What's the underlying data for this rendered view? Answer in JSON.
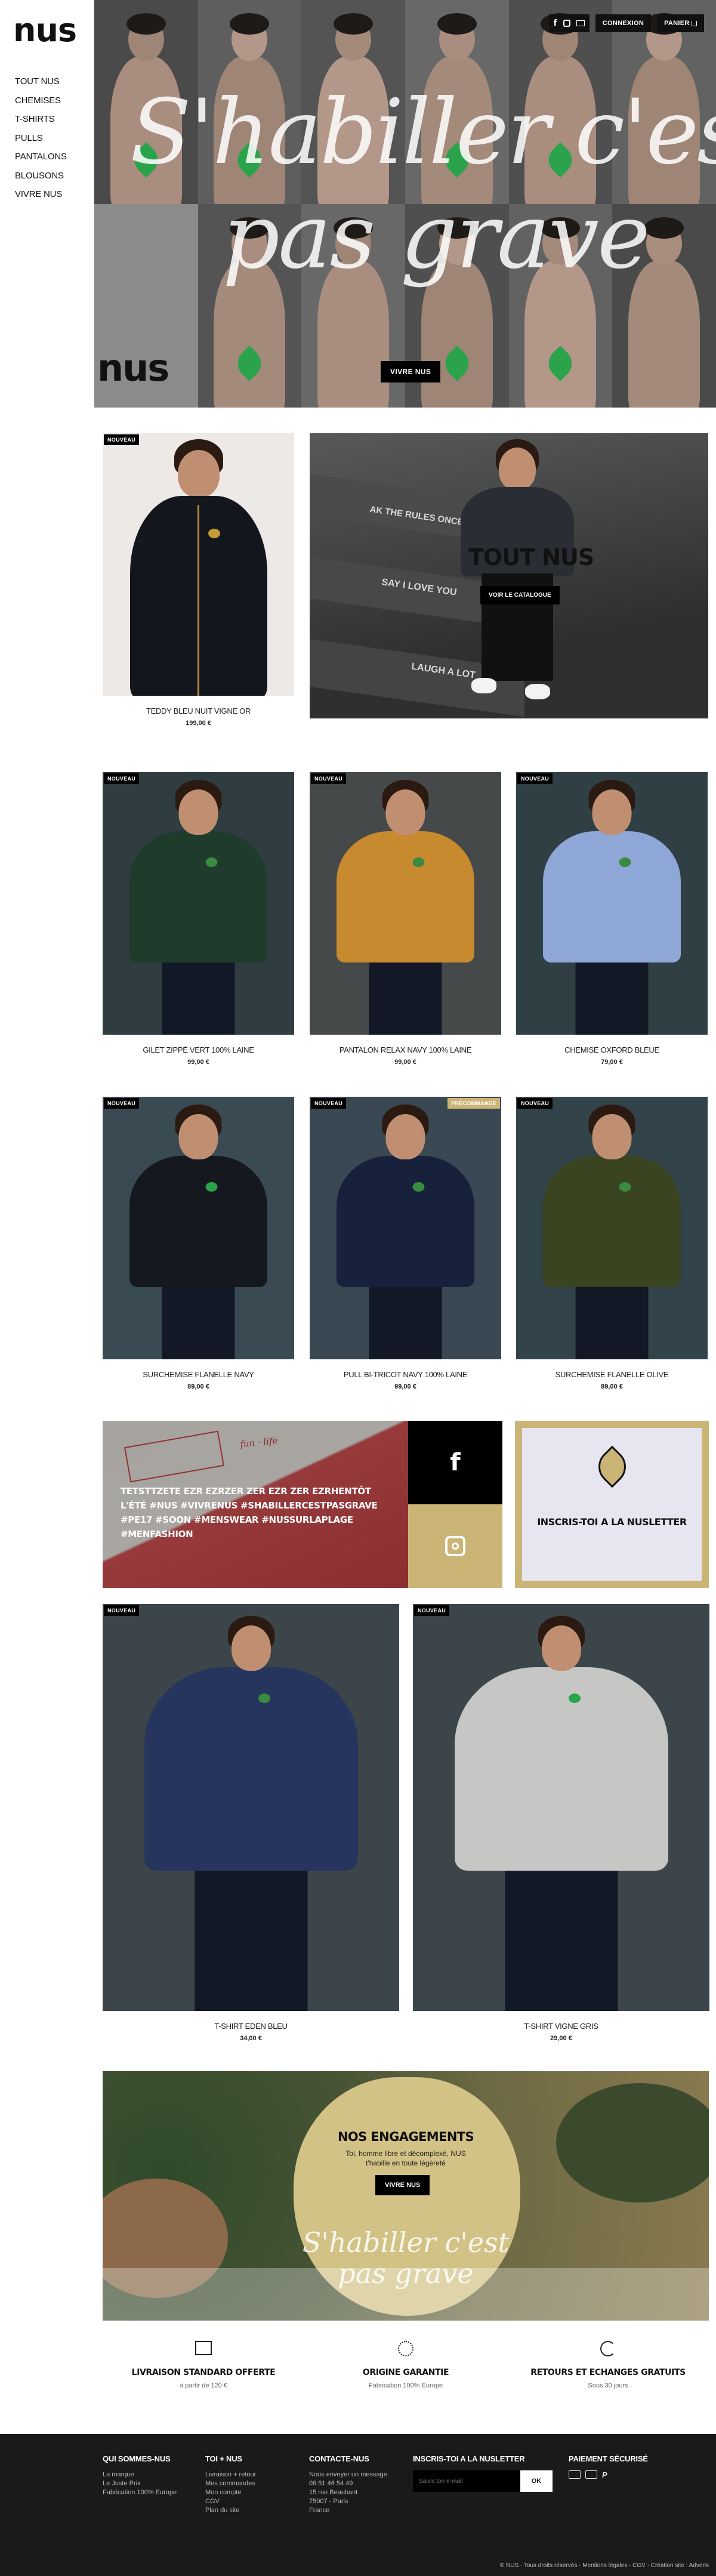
{
  "brand": {
    "logo_text": "nus"
  },
  "sidenav": [
    "TOUT NUS",
    "CHEMISES",
    "T-SHIRTS",
    "PULLS",
    "PANTALONS",
    "BLOUSONS",
    "VIVRE NUS"
  ],
  "hero": {
    "title_line1": "S'habiller c'est",
    "title_line2": "pas grave",
    "logo_text": "nus",
    "cta": "VIVRE NUS",
    "login": "CONNEXION",
    "cart": "PANIER",
    "social_icons": [
      "facebook-icon",
      "instagram-icon",
      "mail-icon"
    ]
  },
  "featured": {
    "product": {
      "badge": "NOUVEAU",
      "name": "TEDDY BLEU NUIT VIGNE OR",
      "price": "199,00 €"
    },
    "banner": {
      "title": "TOUT NUS",
      "cta": "VOIR LE CATALOGUE",
      "stair_words": [
        "AK THE RULES ONCE",
        "SAY I LOVE YOU",
        "LAUGH A LOT"
      ]
    }
  },
  "grid_row1": [
    {
      "badge": "NOUVEAU",
      "name": "GILET ZIPPÉ VERT 100% LAINE",
      "price": "99,00 €",
      "bg": "#2f3c40",
      "shirt": "#1f3b2c"
    },
    {
      "badge": "NOUVEAU",
      "name": "PANTALON RELAX NAVY 100% LAINE",
      "price": "99,00 €",
      "bg": "#46494a",
      "shirt": "#c88a2e"
    },
    {
      "badge": "NOUVEAU",
      "name": "CHEMISE OXFORD BLEUE",
      "price": "79,00 €",
      "bg": "#2f3f44",
      "shirt": "#8fa7d6"
    }
  ],
  "grid_row2": [
    {
      "badge": "NOUVEAU",
      "name": "SURCHEMISE FLANELLE NAVY",
      "price": "89,00 €",
      "bg": "#3a4a52",
      "shirt": "#15181e"
    },
    {
      "badge": "NOUVEAU",
      "badge2": "PRÉCOMMANDE",
      "name": "PULL BI-TRICOT NAVY 100% LAINE",
      "price": "99,00 €",
      "bg": "#394852",
      "shirt": "#18213b"
    },
    {
      "badge": "NOUVEAU",
      "name": "SURCHEMISE FLANELLE OLIVE",
      "price": "89,00 €",
      "bg": "#33434a",
      "shirt": "#3a4421"
    }
  ],
  "social": {
    "post_text": "TETSTTZETE EZR EZRZER ZER EZR ZER EZRHENTÔT L'ÉTÉ #NUS #VIVRENUS #SHABILLERCESTPASGRAVE #PE17 #SOON #MENSWEAR #NUSSURLAPLAGE #MENFASHION",
    "newsletter": "INSCRIS-TOI A LA NUSLETTER"
  },
  "grid_row3": [
    {
      "badge": "NOUVEAU",
      "name": "T-SHIRT EDEN BLEU",
      "price": "34,00 €",
      "shirt": "#25355e"
    },
    {
      "badge": "NOUVEAU",
      "name": "T-SHIRT VIGNE GRIS",
      "price": "29,00 €",
      "shirt": "#c6c7c5"
    }
  ],
  "engagements": {
    "title": "NOS ENGAGEMENTS",
    "text": "Toi, homme libre et décomplexé, NUS t'habille en toute légèreté",
    "cta": "VIVRE NUS",
    "script_line1": "S'habiller c'est",
    "script_line2": "pas grave"
  },
  "reassurance": [
    {
      "icon": "box-icon",
      "title": "LIVRAISON STANDARD OFFERTE",
      "sub": "à partir de 120 €"
    },
    {
      "icon": "origin-icon",
      "title": "ORIGINE GARANTIE",
      "sub": "Fabrication 100% Europe"
    },
    {
      "icon": "return-icon",
      "title": "RETOURS ET ECHANGES GRATUITS",
      "sub": "Sous 30 jours"
    }
  ],
  "footer": {
    "col1": {
      "title": "QUI SOMMES-NUS",
      "links": [
        "La marque",
        "Le Juste Prix",
        "Fabrication 100% Europe"
      ]
    },
    "col2": {
      "title": "TOI + NUS",
      "links": [
        "Livraison + retour",
        "Mes commandes",
        "Mon compte",
        "CGV",
        "Plan du site"
      ]
    },
    "col3": {
      "title": "CONTACTE-NUS",
      "links": [
        "Nous envoyer un message",
        "09 51 46 54 49",
        "15 rue Beaubant",
        "75007 - Paris",
        "France"
      ]
    },
    "col4": {
      "title": "INSCRIS-TOI A LA NUSLETTER",
      "placeholder": "Saisis ton e-mail",
      "submit": "OK"
    },
    "col5": {
      "title": "PAIEMENT SÉCURISÉ",
      "icons": [
        "card-icon",
        "card-icon",
        "paypal-icon"
      ]
    },
    "legal": "© NUS · Tous droits réservés · Mentions légales · CGV · Création site : Adveris"
  },
  "colors": {
    "gold": "#cbb576",
    "dark": "#111111",
    "green": "#2aa34a",
    "footer": "#1a1a1a"
  }
}
